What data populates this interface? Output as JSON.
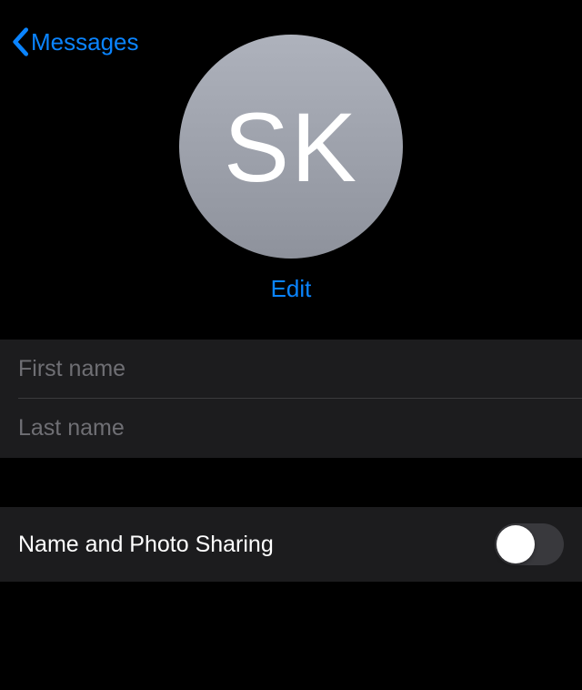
{
  "header": {
    "back_label": "Messages"
  },
  "profile": {
    "initials": "SK",
    "edit_label": "Edit"
  },
  "fields": {
    "first_name_placeholder": "First name",
    "first_name_value": "",
    "last_name_placeholder": "Last name",
    "last_name_value": ""
  },
  "settings": {
    "sharing_label": "Name and Photo Sharing",
    "sharing_enabled": false
  },
  "colors": {
    "accent": "#0a84ff",
    "background": "#000000",
    "cell": "#1c1c1e"
  }
}
